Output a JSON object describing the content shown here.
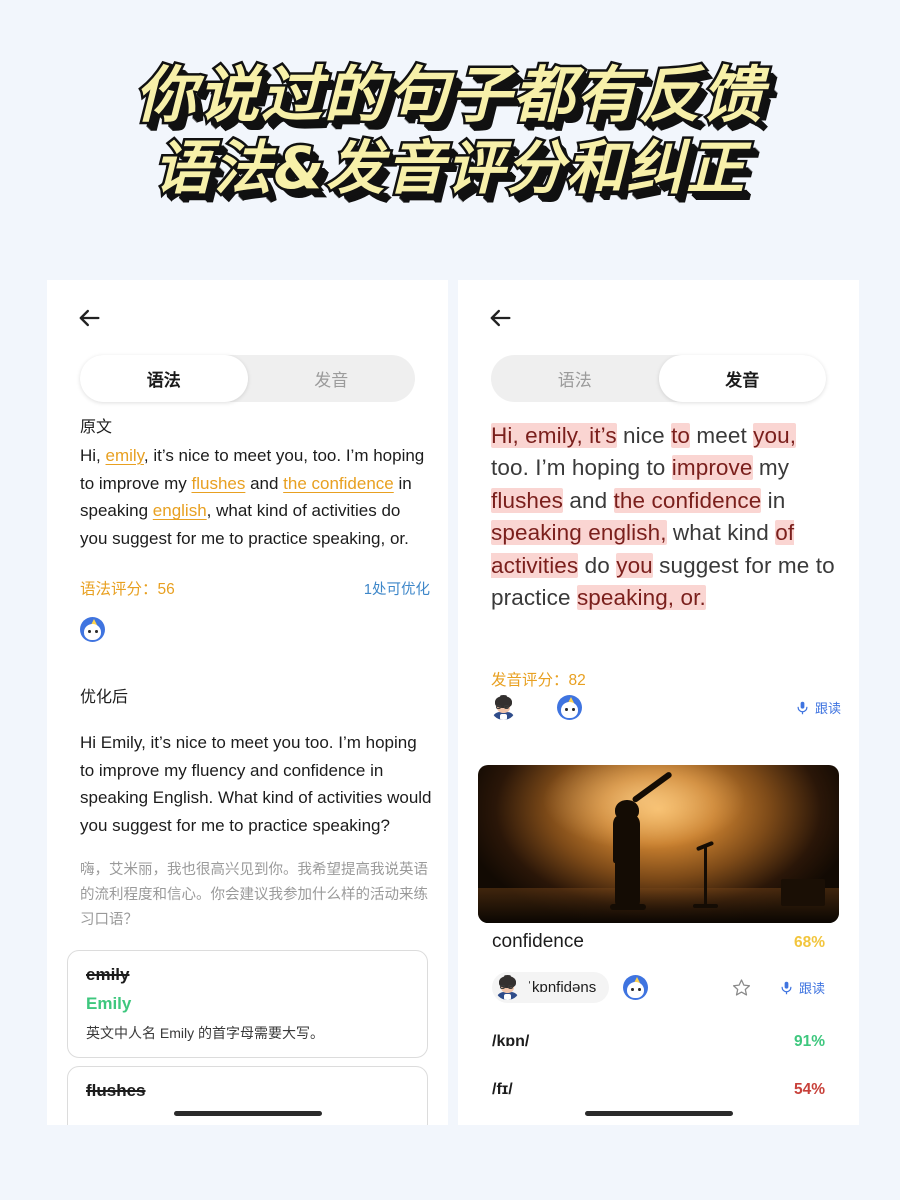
{
  "banner": {
    "line1": "你说过的句子都有反馈",
    "line2": "语法&发音评分和纠正",
    "fill_color": "#f7f0a9",
    "outline_color": "#111111"
  },
  "left_panel": {
    "back_icon": "back-arrow-icon",
    "tabs": [
      {
        "label": "语法",
        "active": true
      },
      {
        "label": "发音",
        "active": false
      }
    ],
    "original_label": "原文",
    "original_text": {
      "segments": [
        {
          "text": "Hi, ",
          "error": false
        },
        {
          "text": "emily",
          "error": true
        },
        {
          "text": ", it’s nice to meet you, too. I’m hoping to improve my ",
          "error": false
        },
        {
          "text": "flushes",
          "error": true
        },
        {
          "text": " and ",
          "error": false
        },
        {
          "text": "the confidence",
          "error": true
        },
        {
          "text": " in speaking ",
          "error": false
        },
        {
          "text": "english",
          "error": true
        },
        {
          "text": ", what kind of activities do you suggest for me to practice speaking, or.",
          "error": false
        }
      ]
    },
    "score_label": "语法评分：",
    "score_value": "56",
    "score_color": "#e8a021",
    "optimize_link": "1处可优化",
    "optimize_link_color": "#3e87c9",
    "speaker_avatar": "unicorn-avatar-icon",
    "optimized_label": "优化后",
    "optimized_text": "Hi Emily, it’s nice to meet you too. I’m hoping to improve my fluency and confidence in speaking English. What kind of activities would you suggest for me to practice speaking?",
    "optimized_translation": "嗨，艾米丽，我也很高兴见到你。我希望提高我说英语的流利程度和信心。你会建议我参加什么样的活动来练习口语？",
    "corrections": [
      {
        "original": "emily",
        "corrected": "Emily",
        "note": "英文中人名 Emily 的首字母需要大写。"
      },
      {
        "original": "flushes",
        "corrected": "",
        "note": ""
      }
    ],
    "correction_color": "#3ec77e"
  },
  "right_panel": {
    "back_icon": "back-arrow-icon",
    "tabs": [
      {
        "label": "语法",
        "active": false
      },
      {
        "label": "发音",
        "active": true
      }
    ],
    "pronunciation_text": {
      "segments": [
        {
          "text": "Hi, emily, it’s",
          "highlight": true
        },
        {
          "text": " nice ",
          "highlight": false
        },
        {
          "text": "to",
          "highlight": true
        },
        {
          "text": " meet ",
          "highlight": false
        },
        {
          "text": "you,",
          "highlight": true
        },
        {
          "text": " too. I’m hoping to ",
          "highlight": false
        },
        {
          "text": "improve",
          "highlight": true
        },
        {
          "text": " my ",
          "highlight": false
        },
        {
          "text": "flushes",
          "highlight": true
        },
        {
          "text": " and ",
          "highlight": false
        },
        {
          "text": "the confidence",
          "highlight": true
        },
        {
          "text": " in ",
          "highlight": false
        },
        {
          "text": "speaking english,",
          "highlight": true
        },
        {
          "text": " what ",
          "highlight": false
        },
        {
          "text": "kind",
          "highlight": false
        },
        {
          "text": " ",
          "highlight": false
        },
        {
          "text": "of activities",
          "highlight": true
        },
        {
          "text": " do ",
          "highlight": false
        },
        {
          "text": "you",
          "highlight": true
        },
        {
          "text": " suggest for me to practice ",
          "highlight": false
        },
        {
          "text": "speaking, or.",
          "highlight": true
        }
      ]
    },
    "highlight_bg": "#fad5d2",
    "score_label": "发音评分：",
    "score_value": "82",
    "score_color": "#e8a021",
    "user_avatar": "person-avatar-icon",
    "tutor_avatar": "unicorn-avatar-icon",
    "follow_read_label": "跟读",
    "follow_read_icon": "microphone-icon",
    "stage_image_alt": "stage-performer-silhouette",
    "word_card": {
      "word": "confidence",
      "word_score": "68%",
      "word_score_color": "#f2c53d",
      "ipa": "ˈkɒnfidəns",
      "star_icon": "star-outline-icon",
      "follow_read_label": "跟读",
      "phonemes": [
        {
          "ipa": "/kɒn/",
          "score": "91%",
          "color": "#3ec77e"
        },
        {
          "ipa": "/fɪ/",
          "score": "54%",
          "color": "#c8413a"
        }
      ]
    }
  }
}
